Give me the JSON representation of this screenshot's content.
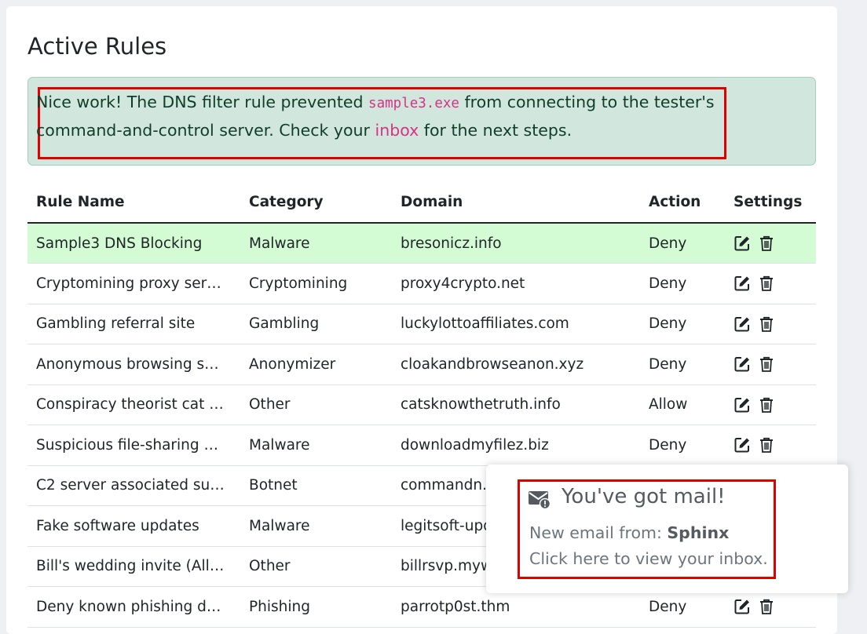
{
  "page": {
    "title": "Active Rules"
  },
  "alert": {
    "text_before": "Nice work! The DNS filter rule prevented ",
    "code": "sample3.exe",
    "text_middle": " from connecting to the tester's command-and-control server. Check your ",
    "link": "inbox",
    "text_after": " for the next steps."
  },
  "table": {
    "headers": [
      "Rule Name",
      "Category",
      "Domain",
      "Action",
      "Settings"
    ],
    "rows": [
      {
        "name": "Sample3 DNS Blocking",
        "category": "Malware",
        "domain": "bresonicz.info",
        "action": "Deny"
      },
      {
        "name": "Cryptomining proxy ser…",
        "category": "Cryptomining",
        "domain": "proxy4crypto.net",
        "action": "Deny"
      },
      {
        "name": "Gambling referral site",
        "category": "Gambling",
        "domain": "luckylottoaffiliates.com",
        "action": "Deny"
      },
      {
        "name": "Anonymous browsing s…",
        "category": "Anonymizer",
        "domain": "cloakandbrowseanon.xyz",
        "action": "Deny"
      },
      {
        "name": "Conspiracy theorist cat …",
        "category": "Other",
        "domain": "catsknowthetruth.info",
        "action": "Allow"
      },
      {
        "name": "Suspicious file-sharing …",
        "category": "Malware",
        "domain": "downloadmyfilez.biz",
        "action": "Deny"
      },
      {
        "name": "C2 server associated su…",
        "category": "Botnet",
        "domain": "commandn.c",
        "action": ""
      },
      {
        "name": "Fake software updates",
        "category": "Malware",
        "domain": "legitsoft-upd",
        "action": ""
      },
      {
        "name": "Bill's wedding invite (All…",
        "category": "Other",
        "domain": "billrsvp.myw",
        "action": ""
      },
      {
        "name": "Deny known phishing d…",
        "category": "Phishing",
        "domain": "parrotp0st.thm",
        "action": "Deny"
      }
    ]
  },
  "toast": {
    "title": "You've got mail!",
    "from_label": "New email from: ",
    "from_name": "Sphinx",
    "cta": "Click here to view your inbox."
  },
  "icons": {
    "edit": "edit-icon",
    "delete": "trash-icon",
    "mail": "mail-alert-icon"
  },
  "colors": {
    "highlight_row": "#d4fcd4",
    "alert_bg": "#d1e7dd",
    "annotation_box": "#e00000",
    "code": "#d63384"
  }
}
